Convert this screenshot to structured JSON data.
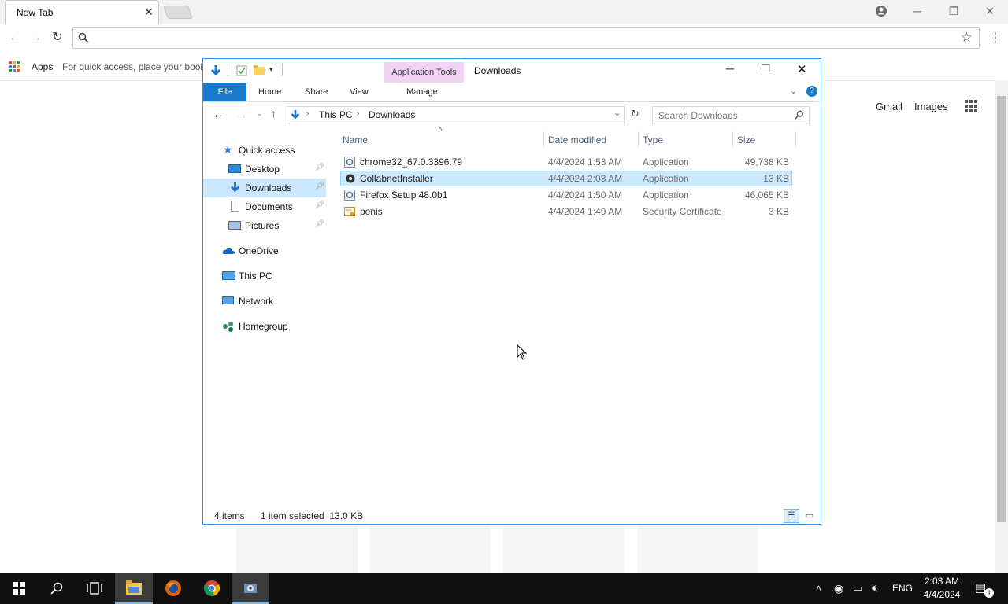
{
  "browser": {
    "tab_title": "New Tab",
    "tab_close": "✕",
    "win_minimize": "─",
    "win_restore": "❐",
    "win_close": "✕",
    "apps_label": "Apps",
    "bookmark_hint": "For quick access, place your book",
    "gmail": "Gmail",
    "images": "Images"
  },
  "explorer": {
    "title": "Downloads",
    "app_tools": "Application Tools",
    "ribbon_tabs": [
      "File",
      "Home",
      "Share",
      "View",
      "Manage"
    ],
    "address": {
      "root": "This PC",
      "folder": "Downloads"
    },
    "search_placeholder": "Search Downloads",
    "nav": [
      {
        "label": "Quick access",
        "icon": "star-icon"
      },
      {
        "label": "Desktop",
        "icon": "desktop-icon",
        "pinned": true
      },
      {
        "label": "Downloads",
        "icon": "download-arrow-icon",
        "pinned": true,
        "selected": true
      },
      {
        "label": "Documents",
        "icon": "document-icon",
        "pinned": true
      },
      {
        "label": "Pictures",
        "icon": "pictures-icon",
        "pinned": true
      },
      {
        "label": "OneDrive",
        "icon": "cloud-icon"
      },
      {
        "label": "This PC",
        "icon": "computer-icon"
      },
      {
        "label": "Network",
        "icon": "network-icon"
      },
      {
        "label": "Homegroup",
        "icon": "homegroup-icon"
      }
    ],
    "columns": [
      "Name",
      "Date modified",
      "Type",
      "Size"
    ],
    "files": [
      {
        "name": "chrome32_67.0.3396.79",
        "date": "4/4/2024 1:53 AM",
        "type": "Application",
        "size": "49,738 KB",
        "icon": "installer-icon"
      },
      {
        "name": "CollabnetInstaller",
        "date": "4/4/2024 2:03 AM",
        "type": "Application",
        "size": "13 KB",
        "icon": "gear-app-icon",
        "selected": true
      },
      {
        "name": "Firefox Setup 48.0b1",
        "date": "4/4/2024 1:50 AM",
        "type": "Application",
        "size": "46,065 KB",
        "icon": "installer-icon"
      },
      {
        "name": "penis",
        "date": "4/4/2024 1:49 AM",
        "type": "Security Certificate",
        "size": "3 KB",
        "icon": "certificate-icon"
      }
    ],
    "status": {
      "count": "4 items",
      "selected": "1 item selected  13.0 KB"
    }
  },
  "taskbar": {
    "language": "ENG",
    "time": "2:03 AM",
    "date": "4/4/2024",
    "notification_count": "1"
  }
}
